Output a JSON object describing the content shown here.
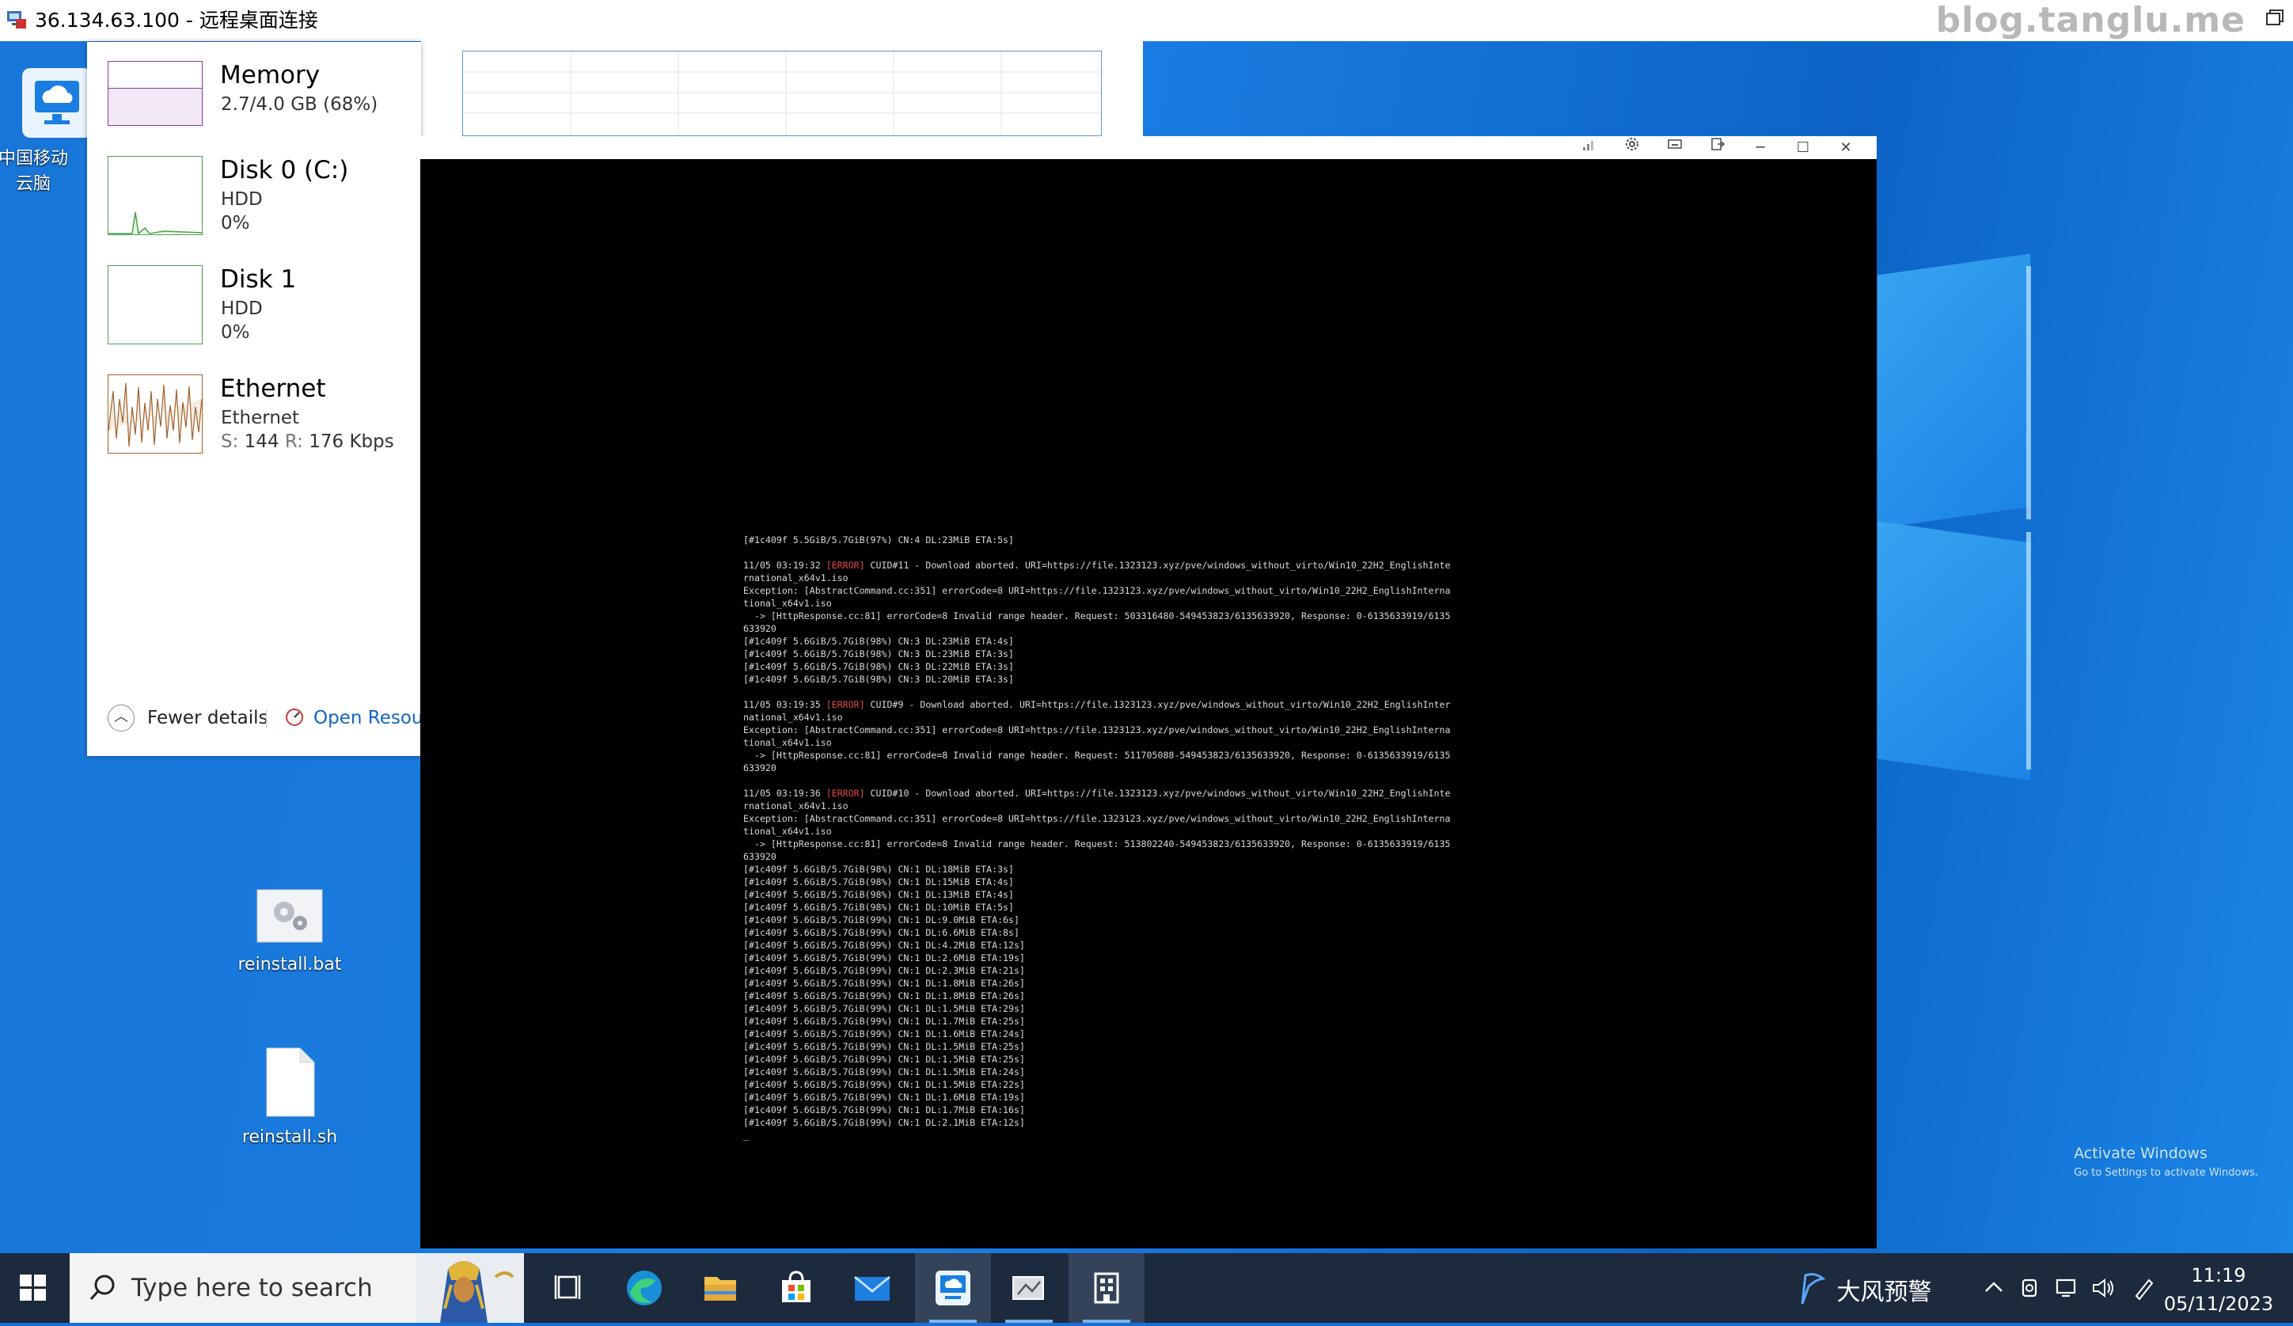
{
  "rdp": {
    "title": "36.134.63.100 - 远程桌面连接",
    "brand": "blog.tanglu.me"
  },
  "desktop": {
    "icons": [
      {
        "label": "中国移动云脑",
        "icon": "cloud-computer-icon"
      },
      {
        "label": "reinstall.bat",
        "icon": "gear-file-icon"
      },
      {
        "label": "reinstall.sh",
        "icon": "blank-file-icon"
      }
    ],
    "activate": {
      "line1": "Activate Windows",
      "line2": "Go to Settings to activate Windows."
    }
  },
  "taskmgr": {
    "items": [
      {
        "title": "Memory",
        "sub1": "2.7/4.0 GB (68%)",
        "sub2": ""
      },
      {
        "title": "Disk 0 (C:)",
        "sub1": "HDD",
        "sub2": "0%"
      },
      {
        "title": "Disk 1",
        "sub1": "HDD",
        "sub2": "0%"
      },
      {
        "title": "Ethernet",
        "sub1": "Ethernet",
        "sub2_s": "S:",
        "sub2_sv": "144",
        "sub2_r": "R:",
        "sub2_rv": "176 Kbps"
      }
    ],
    "fewer_details": "Fewer details",
    "open_resource": "Open Resource Monitor"
  },
  "console": {
    "lines": [
      "[#1c409f 5.5GiB/5.7GiB(97%) CN:4 DL:23MiB ETA:5s]",
      "",
      "11/05 03:19:32 [ERROR] CUID#11 - Download aborted. URI=https://file.1323123.xyz/pve/windows_without_virto/Win10_22H2_EnglishInte",
      "rnational_x64v1.iso",
      "Exception: [AbstractCommand.cc:351] errorCode=8 URI=https://file.1323123.xyz/pve/windows_without_virto/Win10_22H2_EnglishInterna",
      "tional_x64v1.iso",
      "  -> [HttpResponse.cc:81] errorCode=8 Invalid range header. Request: 503316480-549453823/6135633920, Response: 0-6135633919/6135",
      "633920",
      "[#1c409f 5.6GiB/5.7GiB(98%) CN:3 DL:23MiB ETA:4s]",
      "[#1c409f 5.6GiB/5.7GiB(98%) CN:3 DL:23MiB ETA:3s]",
      "[#1c409f 5.6GiB/5.7GiB(98%) CN:3 DL:22MiB ETA:3s]",
      "[#1c409f 5.6GiB/5.7GiB(98%) CN:3 DL:20MiB ETA:3s]",
      "",
      "11/05 03:19:35 [ERROR] CUID#9 - Download aborted. URI=https://file.1323123.xyz/pve/windows_without_virto/Win10_22H2_EnglishInter",
      "national_x64v1.iso",
      "Exception: [AbstractCommand.cc:351] errorCode=8 URI=https://file.1323123.xyz/pve/windows_without_virto/Win10_22H2_EnglishInterna",
      "tional_x64v1.iso",
      "  -> [HttpResponse.cc:81] errorCode=8 Invalid range header. Request: 511705088-549453823/6135633920, Response: 0-6135633919/6135",
      "633920",
      "",
      "11/05 03:19:36 [ERROR] CUID#10 - Download aborted. URI=https://file.1323123.xyz/pve/windows_without_virto/Win10_22H2_EnglishInte",
      "rnational_x64v1.iso",
      "Exception: [AbstractCommand.cc:351] errorCode=8 URI=https://file.1323123.xyz/pve/windows_without_virto/Win10_22H2_EnglishInterna",
      "tional_x64v1.iso",
      "  -> [HttpResponse.cc:81] errorCode=8 Invalid range header. Request: 513802240-549453823/6135633920, Response: 0-6135633919/6135",
      "633920",
      "[#1c409f 5.6GiB/5.7GiB(98%) CN:1 DL:18MiB ETA:3s]",
      "[#1c409f 5.6GiB/5.7GiB(98%) CN:1 DL:15MiB ETA:4s]",
      "[#1c409f 5.6GiB/5.7GiB(98%) CN:1 DL:13MiB ETA:4s]",
      "[#1c409f 5.6GiB/5.7GiB(98%) CN:1 DL:10MiB ETA:5s]",
      "[#1c409f 5.6GiB/5.7GiB(99%) CN:1 DL:9.0MiB ETA:6s]",
      "[#1c409f 5.6GiB/5.7GiB(99%) CN:1 DL:6.6MiB ETA:8s]",
      "[#1c409f 5.6GiB/5.7GiB(99%) CN:1 DL:4.2MiB ETA:12s]",
      "[#1c409f 5.6GiB/5.7GiB(99%) CN:1 DL:2.6MiB ETA:19s]",
      "[#1c409f 5.6GiB/5.7GiB(99%) CN:1 DL:2.3MiB ETA:21s]",
      "[#1c409f 5.6GiB/5.7GiB(99%) CN:1 DL:1.8MiB ETA:26s]",
      "[#1c409f 5.6GiB/5.7GiB(99%) CN:1 DL:1.8MiB ETA:26s]",
      "[#1c409f 5.6GiB/5.7GiB(99%) CN:1 DL:1.5MiB ETA:29s]",
      "[#1c409f 5.6GiB/5.7GiB(99%) CN:1 DL:1.7MiB ETA:25s]",
      "[#1c409f 5.6GiB/5.7GiB(99%) CN:1 DL:1.6MiB ETA:24s]",
      "[#1c409f 5.6GiB/5.7GiB(99%) CN:1 DL:1.5MiB ETA:25s]",
      "[#1c409f 5.6GiB/5.7GiB(99%) CN:1 DL:1.5MiB ETA:25s]",
      "[#1c409f 5.6GiB/5.7GiB(99%) CN:1 DL:1.5MiB ETA:24s]",
      "[#1c409f 5.6GiB/5.7GiB(99%) CN:1 DL:1.5MiB ETA:22s]",
      "[#1c409f 5.6GiB/5.7GiB(99%) CN:1 DL:1.6MiB ETA:19s]",
      "[#1c409f 5.6GiB/5.7GiB(99%) CN:1 DL:1.7MiB ETA:16s]",
      "[#1c409f 5.6GiB/5.7GiB(99%) CN:1 DL:2.1MiB ETA:12s]",
      "_"
    ],
    "error_tag": "[ERROR]",
    "error_color": "#e04848"
  },
  "taskbar": {
    "search_placeholder": "Type here to search",
    "apps": [
      "task-view-icon",
      "edge-icon",
      "file-explorer-icon",
      "store-icon",
      "mail-icon",
      "remote-desktop-icon",
      "network-app-icon",
      "building-app-icon"
    ],
    "weather": "大风预警",
    "time": "11:19",
    "date": "05/11/2023"
  }
}
